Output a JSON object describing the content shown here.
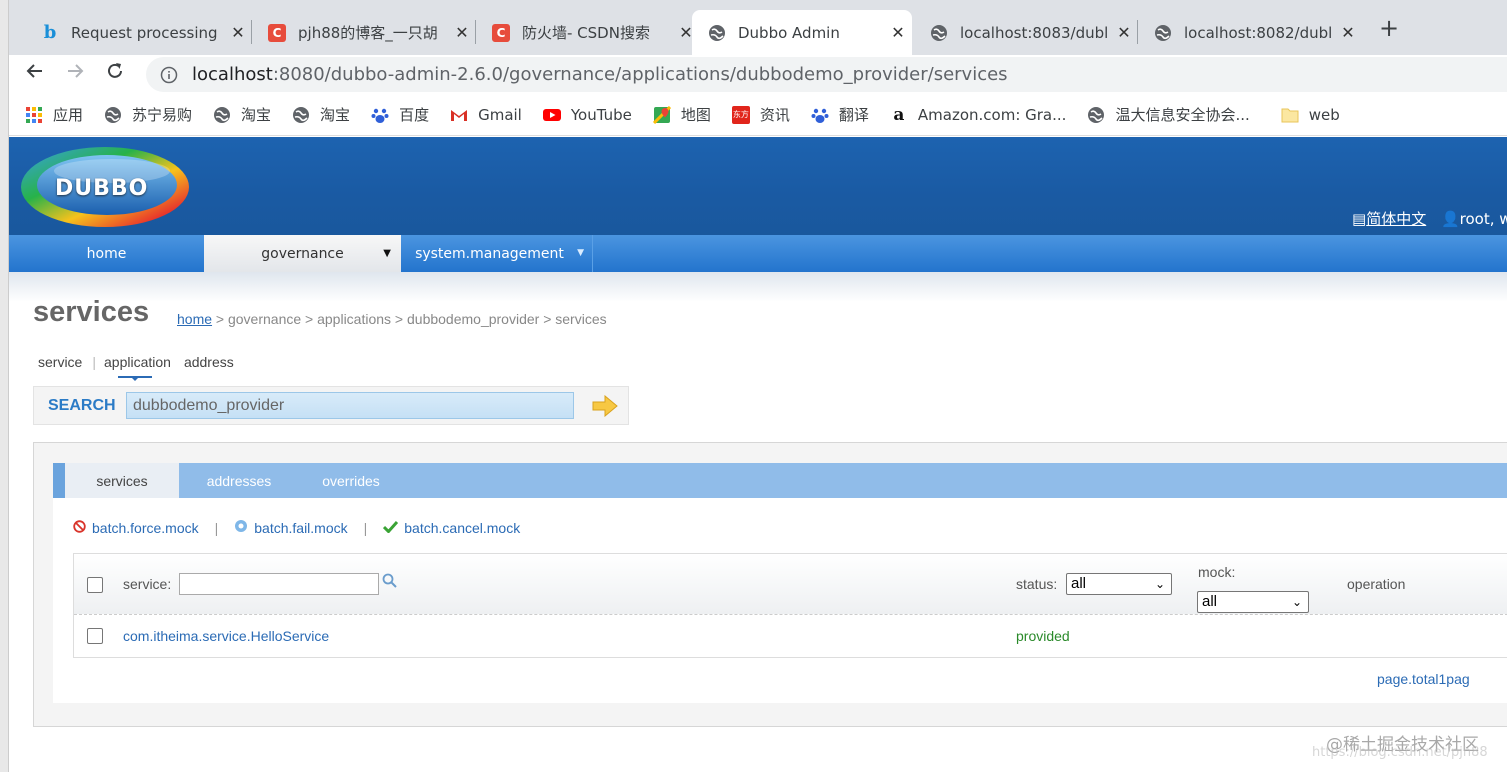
{
  "browser": {
    "tabs": [
      {
        "title": "Request processing",
        "icon": "bing-icon"
      },
      {
        "title": "pjh88的博客_一只胡",
        "icon": "csdn-icon"
      },
      {
        "title": "防火墙- CSDN搜索",
        "icon": "csdn-icon"
      },
      {
        "title": "Dubbo Admin",
        "icon": "globe-icon",
        "active": true
      },
      {
        "title": "localhost:8083/dubl",
        "icon": "globe-icon"
      },
      {
        "title": "localhost:8082/dubl",
        "icon": "globe-icon"
      }
    ],
    "url_host": "localhost",
    "url_path": ":8080/dubbo-admin-2.6.0/governance/applications/dubbodemo_provider/services",
    "bookmarks": [
      {
        "label": "应用",
        "icon": "apps-grid-icon"
      },
      {
        "label": "苏宁易购",
        "icon": "globe-icon"
      },
      {
        "label": "淘宝",
        "icon": "globe-icon"
      },
      {
        "label": "淘宝",
        "icon": "globe-icon"
      },
      {
        "label": "百度",
        "icon": "baidu-icon"
      },
      {
        "label": "Gmail",
        "icon": "gmail-icon"
      },
      {
        "label": "YouTube",
        "icon": "youtube-icon"
      },
      {
        "label": "地图",
        "icon": "maps-icon"
      },
      {
        "label": "资讯",
        "icon": "news-icon"
      },
      {
        "label": "翻译",
        "icon": "baidu-icon"
      },
      {
        "label": "Amazon.com: Gra...",
        "icon": "amazon-icon"
      },
      {
        "label": "温大信息安全协会...",
        "icon": "globe-icon"
      },
      {
        "label": "web",
        "icon": "folder-icon"
      }
    ]
  },
  "header": {
    "logo_text": "DUBBO",
    "language": "简体中文",
    "user": "root, we"
  },
  "nav": {
    "home": "home",
    "governance": "governance",
    "system_management": "system.management"
  },
  "page": {
    "title": "services",
    "breadcrumb_home": "home",
    "breadcrumb_rest": " > governance > applications > dubbodemo_provider > services"
  },
  "search": {
    "tab_service": "service",
    "tab_application": "application",
    "tab_address": "address",
    "label": "SEARCH",
    "value": "dubbodemo_provider"
  },
  "subtabs": {
    "services": "services",
    "addresses": "addresses",
    "overrides": "overrides"
  },
  "batch": {
    "force_mock": "batch.force.mock",
    "fail_mock": "batch.fail.mock",
    "cancel_mock": "batch.cancel.mock"
  },
  "table": {
    "col_service": "service:",
    "col_status": "status:",
    "status_selected": "all",
    "col_mock": "mock:",
    "mock_selected": "all",
    "col_operation": "operation",
    "rows": [
      {
        "service": "com.itheima.service.HelloService",
        "status": "provided"
      }
    ]
  },
  "pager": "page.total1pag",
  "watermark": "@稀土掘金技术社区",
  "watermark_url": "https://blog.csdn.net/pjh88",
  "colors": {
    "header_blue": "#1a5aa3",
    "nav_blue": "#2374cd",
    "link_blue": "#2b6bb5",
    "status_green": "#2a8a2a"
  }
}
